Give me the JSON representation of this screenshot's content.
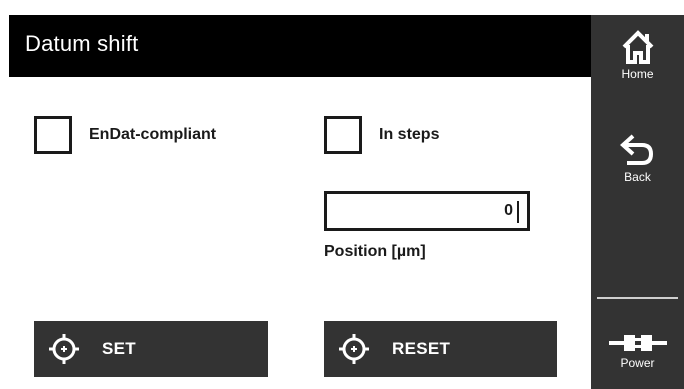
{
  "header": {
    "title": "Datum shift"
  },
  "options": {
    "endat_label": "EnDat-compliant",
    "in_steps_label": "In steps"
  },
  "position": {
    "value": "0",
    "label": "Position [µm]"
  },
  "actions": {
    "set_label": "SET",
    "reset_label": "RESET"
  },
  "sidebar": {
    "home_label": "Home",
    "back_label": "Back",
    "power_label": "Power"
  },
  "icons": {
    "home": "home-icon",
    "back": "back-arrow-icon",
    "power": "power-connector-icon",
    "set": "crosshair-icon",
    "reset": "crosshair-icon"
  },
  "colors": {
    "header_bg": "#000000",
    "sidebar_bg": "#333333",
    "button_bg": "#333333",
    "text_dark": "#1a1a1a"
  }
}
